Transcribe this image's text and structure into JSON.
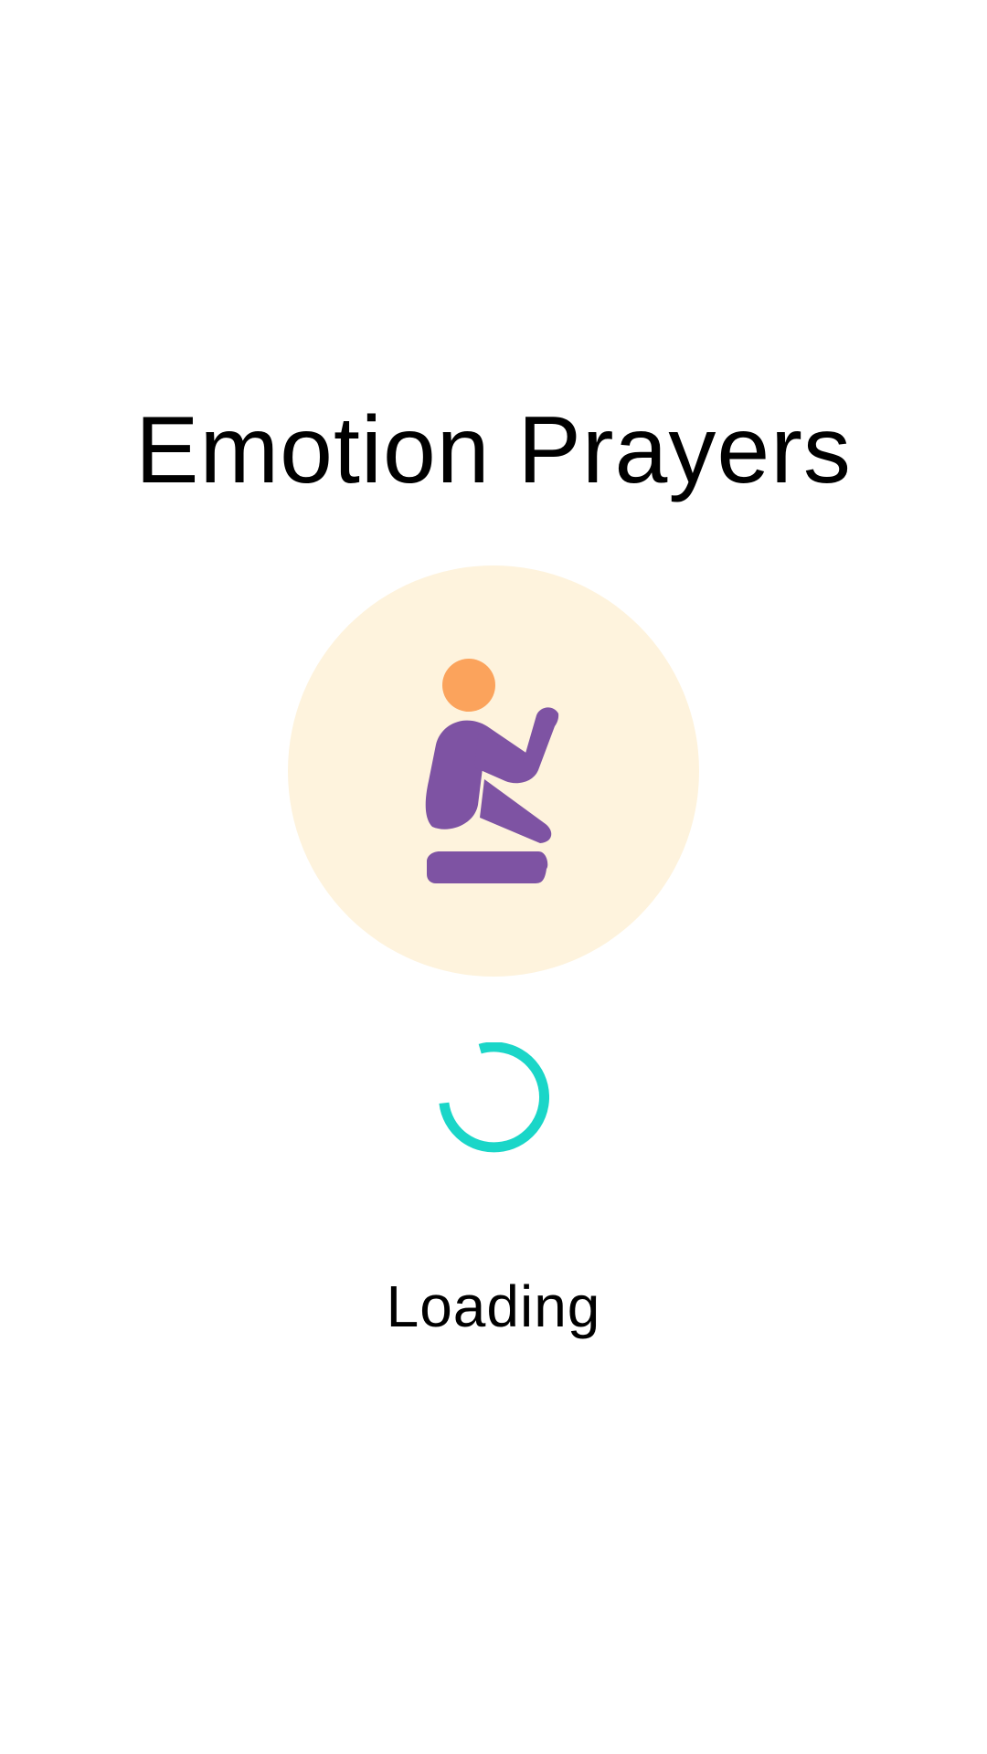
{
  "app": {
    "title": "Emotion Prayers"
  },
  "logo": {
    "icon": "kneeling-prayer-person-icon",
    "background_color": "#FEF3DD",
    "head_color": "#FBA35C",
    "body_color": "#7E53A3"
  },
  "spinner": {
    "icon": "loading-spinner-icon",
    "color": "#1AD6C8"
  },
  "status": {
    "loading_label": "Loading"
  }
}
